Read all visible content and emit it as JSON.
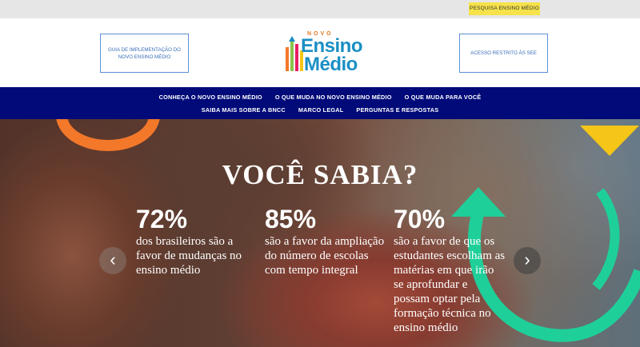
{
  "topbar": {
    "search_label": "PESQUISA ENSINO MÉDIO"
  },
  "header": {
    "left_button": "GUIA DE IMPLEMENTAÇÃO DO NOVO ENSINO MÉDIO",
    "right_button": "ACESSO RESTRITO ÀS SEE",
    "logo": {
      "small": "NOVO",
      "line1": "Ensino",
      "line2": "Médio"
    }
  },
  "nav": {
    "row1": [
      "CONHEÇA O NOVO ENSINO MÉDIO",
      "O QUE MUDA NO NOVO ENSINO MÉDIO",
      "O QUE MUDA PARA VOCÊ"
    ],
    "row2": [
      "SAIBA MAIS SOBRE A BNCC",
      "MARCO LEGAL",
      "PERGUNTAS E RESPOSTAS"
    ]
  },
  "hero": {
    "title": "VOCÊ SABIA?",
    "stats": [
      {
        "value": "72%",
        "text": "dos brasileiros são a favor de mudanças no ensino médio"
      },
      {
        "value": "85%",
        "text": "são a favor da ampliação do número de escolas com tempo integral"
      },
      {
        "value": "70%",
        "text": "são a favor de que os estudantes escolham as matérias em que irão se aprofundar e possam optar pela formação técnica no ensino médio"
      }
    ],
    "prev_icon": "‹",
    "next_icon": "›"
  },
  "colors": {
    "nav_bg": "#000a78",
    "accent_yellow": "#f6e24a",
    "logo_blue": "#1a8fc4",
    "orange": "#f3782a",
    "green": "#1fcf9a"
  }
}
